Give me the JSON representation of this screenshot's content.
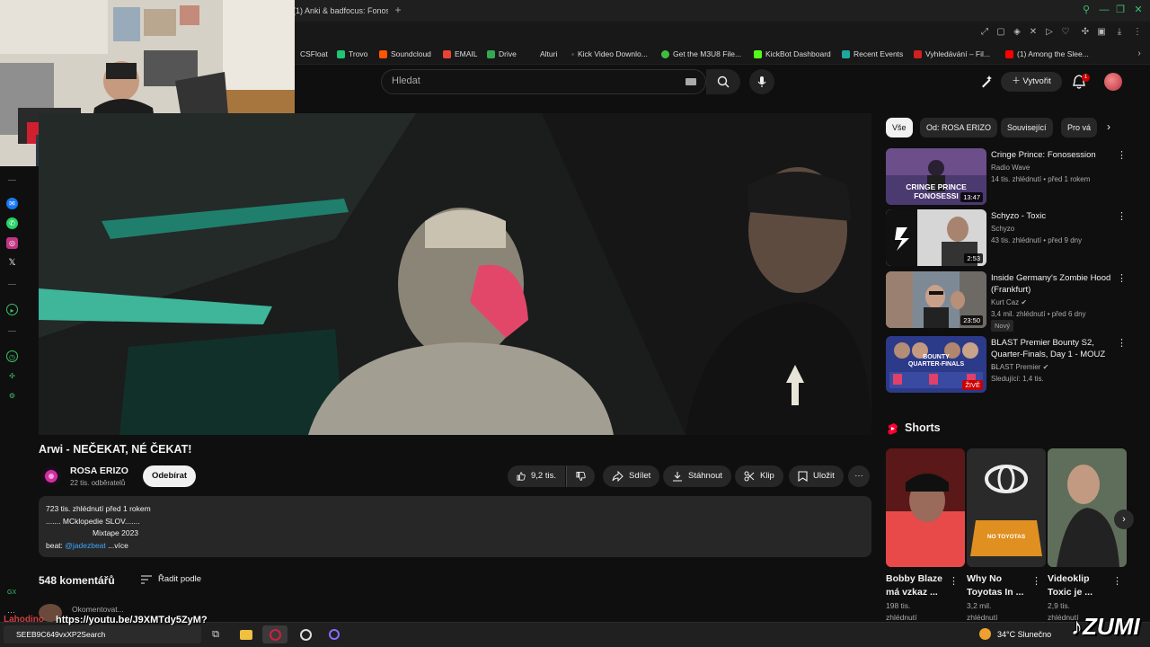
{
  "browser": {
    "tab_title": "(1) Anki & badfocus: Fonos",
    "bookmarks": [
      {
        "label": "CSFloat",
        "color": "#2b2b2b"
      },
      {
        "label": "Trovo",
        "color": "#1ec774"
      },
      {
        "label": "Soundcloud",
        "color": "#ff5500"
      },
      {
        "label": "EMAIL",
        "color": "#ea4335"
      },
      {
        "label": "Drive",
        "color": "#34a853"
      },
      {
        "label": "Alturi",
        "color": "#5a5a5a"
      },
      {
        "label": "Kick Video Downlo...",
        "color": "#444"
      },
      {
        "label": "Get the M3U8 File...",
        "color": "#3fbf3f"
      },
      {
        "label": "KickBot Dashboard",
        "color": "#53fc18"
      },
      {
        "label": "Recent Events",
        "color": "#1fa89f"
      },
      {
        "label": "Vyhledávání – Fil...",
        "color": "#d02020"
      },
      {
        "label": "(1) Among the Slee...",
        "color": "#ff0000"
      }
    ]
  },
  "header": {
    "search_placeholder": "Hledat",
    "create_label": "Vytvořit",
    "notification_count": "1"
  },
  "video": {
    "title": "Arwi - NEČEKAT, NÉ ČEKAT!",
    "channel_name": "ROSA ERIZO",
    "channel_subs": "22 tis. odběratelů",
    "subscribe_label": "Odebírat",
    "likes": "9,2 tis.",
    "share_label": "Sdílet",
    "download_label": "Stáhnout",
    "clip_label": "Klip",
    "save_label": "Uložit"
  },
  "description": {
    "line1": "723 tis. zhlédnutí  před 1 rokem",
    "line2": "....... MCklopedie SLOV.......",
    "line3": "Mixtape 2023",
    "line4_prefix": "beat: ",
    "line4_link": "@jadezbeat",
    "more": "...více"
  },
  "comments": {
    "count": "548 komentářů",
    "sort_label": "Řadit podle",
    "input_placeholder": "Okomentovat..."
  },
  "chips": [
    "Vše",
    "Od: ROSA ERIZO",
    "Související",
    "Pro vá"
  ],
  "recommended": [
    {
      "title": "Cringe Prince: Fonosession",
      "channel": "Radio Wave",
      "meta": "14 tis. zhlédnutí • před 1 rokem",
      "duration": "13:47",
      "thumb_text": "CRINGE PRINCE\nFONOSESSI"
    },
    {
      "title": "Schyzo - Toxic",
      "channel": "Schyzo",
      "meta": "43 tis. zhlédnutí • před 9 dny",
      "duration": "2:53"
    },
    {
      "title": "Inside Germany's Zombie Hood (Frankfurt)",
      "channel": "Kurt Caz",
      "meta": "3,4 mil. zhlédnutí • před 6 dny",
      "duration": "23:50",
      "badge": "Nový"
    },
    {
      "title": "BLAST Premier Bounty S2, Quarter-Finals, Day 1 - MOUZ ...",
      "channel": "BLAST Premier",
      "meta": "Sledující: 1,4 tis.",
      "duration": "ŽIVĚ",
      "thumb_text": "BOUNTY\nQUARTER-FINALS"
    }
  ],
  "shorts": {
    "label": "Shorts",
    "items": [
      {
        "title_line1": "Bobby Blaze",
        "title_line2": "má vzkaz ...",
        "views": "198 tis.",
        "views2": "zhlédnutí"
      },
      {
        "title_line1": "Why No",
        "title_line2": "Toyotas In ...",
        "views": "3,2 mil.",
        "views2": "zhlédnutí",
        "thumb_text": "NO TOYOTAS"
      },
      {
        "title_line1": "Videoklip",
        "title_line2": "Toxic je ...",
        "views": "2,9 tis.",
        "views2": "zhlédnutí"
      }
    ]
  },
  "taskbar": {
    "search_text": "SEEB9C649vxXP2Search",
    "weather": "34°C  Slunečno"
  },
  "overlay": {
    "name": "Lahodino",
    "url": "https://youtu.be/J9XMTdy5ZyM?",
    "brand": "ZUMI"
  }
}
